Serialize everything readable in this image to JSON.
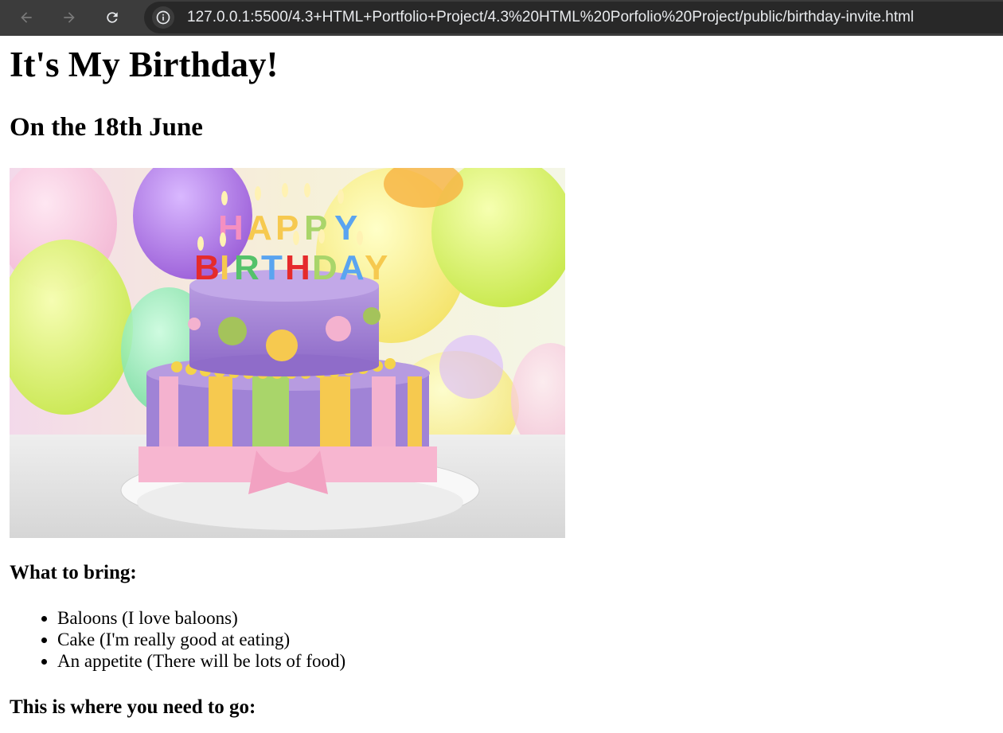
{
  "browser": {
    "url": "127.0.0.1:5500/4.3+HTML+Portfolio+Project/4.3%20HTML%20Porfolio%20Project/public/birthday-invite.html",
    "back_icon": "arrow-left-icon",
    "forward_icon": "arrow-right-icon",
    "reload_icon": "reload-icon",
    "info_icon": "info-icon"
  },
  "page": {
    "title": "It's My Birthday!",
    "date": "On the 18th June",
    "image": {
      "candle_letters_top": "HAPPY",
      "candle_letters_bottom": "BIRTHDAY"
    },
    "bring_heading": "What to bring:",
    "bring_items": [
      "Baloons (I love baloons)",
      "Cake (I'm really good at eating)",
      "An appetite (There will be lots of food)"
    ],
    "where_heading": "This is where you need to go:"
  },
  "colors": {
    "chrome": "#3c3c3c",
    "omnibox": "#282828",
    "url_text": "#e8eaed"
  }
}
